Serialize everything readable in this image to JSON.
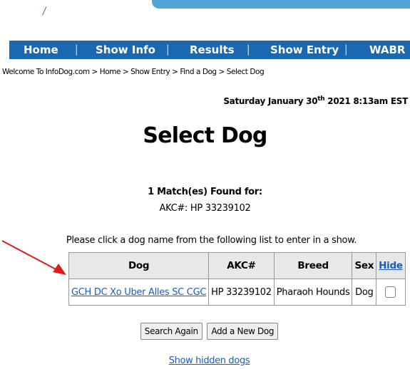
{
  "nav": {
    "items": [
      "Home",
      "Show Info",
      "Results",
      "Show Entry",
      "WABR"
    ]
  },
  "breadcrumb": "Welcome To InfoDog.com > Home > Show Entry > Find a Dog > Select Dog",
  "date": {
    "prefix": "Saturday January 30",
    "suffix": "th",
    "rest": " 2021 8:13am EST"
  },
  "page_title": "Select Dog",
  "match_text": "1 Match(es) Found for:",
  "akc_query": "AKC#: HP 33239102",
  "instruction": "Please click a dog name from the following list to enter in a show.",
  "table": {
    "headers": [
      "Dog",
      "AKC#",
      "Breed",
      "Sex",
      "Hide"
    ],
    "rows": [
      {
        "dog": "GCH DC Xo Uber Alles SC CGC",
        "akc": "HP 33239102",
        "breed": "Pharaoh Hounds",
        "sex": "Dog",
        "hide_checked": false
      }
    ]
  },
  "buttons": {
    "search_again": "Search Again",
    "add_new_dog": "Add a New Dog"
  },
  "show_hidden": "Show hidden dogs",
  "colors": {
    "nav_bg": "#1c68b0",
    "top_bar": "#4fa3d9",
    "link": "#1a5dc0",
    "arrow": "#e01b1b"
  }
}
